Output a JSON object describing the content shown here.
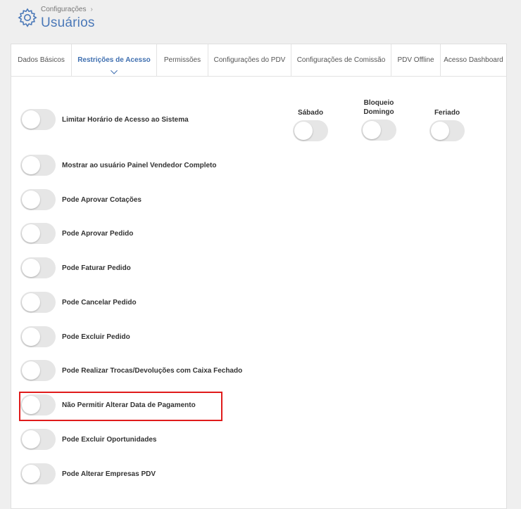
{
  "header": {
    "breadcrumb": "Configurações",
    "title": "Usuários"
  },
  "tabs": [
    {
      "label": "Dados Básicos",
      "active": false
    },
    {
      "label": "Restrições de Acesso",
      "active": true
    },
    {
      "label": "Permissões",
      "active": false
    },
    {
      "label": "Configurações do PDV",
      "active": false
    },
    {
      "label": "Configurações de Comissão",
      "active": false
    },
    {
      "label": "PDV Offline",
      "active": false
    },
    {
      "label": "Acesso Dashboard",
      "active": false
    }
  ],
  "days": [
    {
      "label": "Sábado",
      "on": false
    },
    {
      "label": "Bloqueio Domingo",
      "on": false
    },
    {
      "label": "Feriado",
      "on": false
    }
  ],
  "permissions": [
    {
      "label": "Limitar Horário de Acesso ao Sistema",
      "on": false
    },
    {
      "label": "Mostrar ao usuário Painel Vendedor Completo",
      "on": false
    },
    {
      "label": "Pode Aprovar Cotações",
      "on": false
    },
    {
      "label": "Pode Aprovar Pedido",
      "on": false
    },
    {
      "label": "Pode Faturar Pedido",
      "on": false
    },
    {
      "label": "Pode Cancelar Pedido",
      "on": false
    },
    {
      "label": "Pode Excluir Pedido",
      "on": false
    },
    {
      "label": "Pode Realizar Trocas/Devoluções com Caixa Fechado",
      "on": false
    },
    {
      "label": "Não Permitir Alterar Data de Pagamento",
      "on": false
    },
    {
      "label": "Pode Excluir Oportunidades",
      "on": false
    },
    {
      "label": "Pode Alterar Empresas PDV",
      "on": false
    }
  ],
  "colors": {
    "accent": "#3f6fb0",
    "highlight": "#e01b1b",
    "toggle_off": "#e6e6e6"
  }
}
